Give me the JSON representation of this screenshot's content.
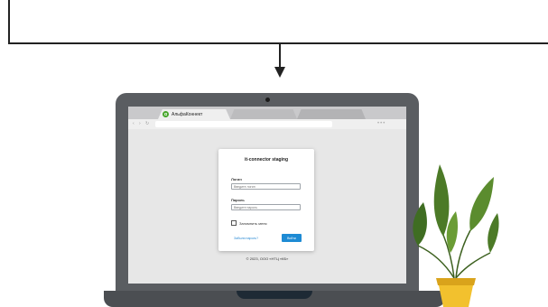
{
  "browser": {
    "active_tab_title": "АльфаКоннект",
    "logo_glyph": "α"
  },
  "login": {
    "title": "it-connector staging",
    "login_label": "Логин",
    "login_placeholder": "Введите логин",
    "password_label": "Пароль",
    "password_placeholder": "Введите пароль",
    "remember_label": "Запомнить меня",
    "forgot_link": "Забыли пароль?",
    "submit_label": "Войти"
  },
  "footer": {
    "copyright": "© 2023, ООО «НТЦ «КБ»"
  },
  "colors": {
    "accent": "#1e8bd4",
    "logo_green": "#46a62b",
    "plant_leaves": "#4c7a27",
    "pot": "#f2c12e"
  },
  "icons": [
    "back-icon",
    "forward-icon",
    "reload-icon",
    "more-icon",
    "tab-logo-icon",
    "arrow-down-icon"
  ]
}
